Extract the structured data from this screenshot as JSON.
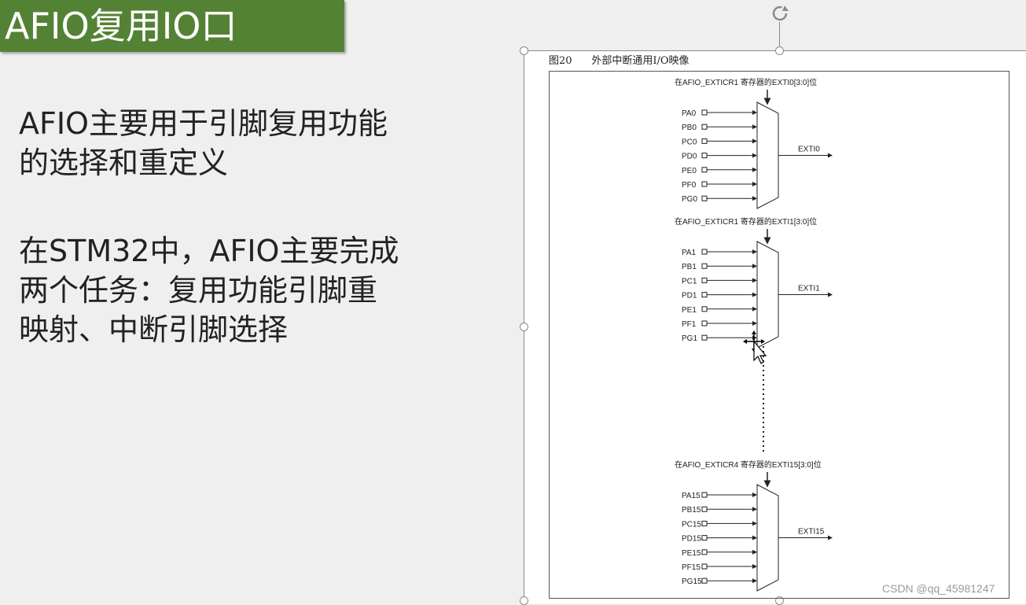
{
  "title": "AFIO复用IO口",
  "paragraphs": [
    "AFIO主要用于引脚复用功能\n的选择和重定义",
    "在STM32中，AFIO主要完成\n两个任务：复用功能引脚重\n映射、中断引脚选择"
  ],
  "figure": {
    "caption": "图20      外部中断通用I/O映像",
    "groups": [
      {
        "register_label": "在AFIO_EXTICR1 寄存器的EXTI0[3:0]位",
        "pins": [
          "PA0",
          "PB0",
          "PC0",
          "PD0",
          "PE0",
          "PF0",
          "PG0"
        ],
        "output": "EXTI0"
      },
      {
        "register_label": "在AFIO_EXTICR1 寄存器的EXTI1[3:0]位",
        "pins": [
          "PA1",
          "PB1",
          "PC1",
          "PD1",
          "PE1",
          "PF1",
          "PG1"
        ],
        "output": "EXTI1"
      },
      {
        "register_label": "在AFIO_EXTICR4 寄存器的EXTI15[3:0]位",
        "pins": [
          "PA15",
          "PB15",
          "PC15",
          "PD15",
          "PE15",
          "PF15",
          "PG15"
        ],
        "output": "EXTI15"
      }
    ]
  },
  "watermark": "CSDN @qq_45981247",
  "colors": {
    "title_bg": "#548235",
    "slide_bg": "#efefef"
  },
  "icons": {
    "rotate": "rotate-handle-icon",
    "cursor": "move-cursor-icon"
  }
}
